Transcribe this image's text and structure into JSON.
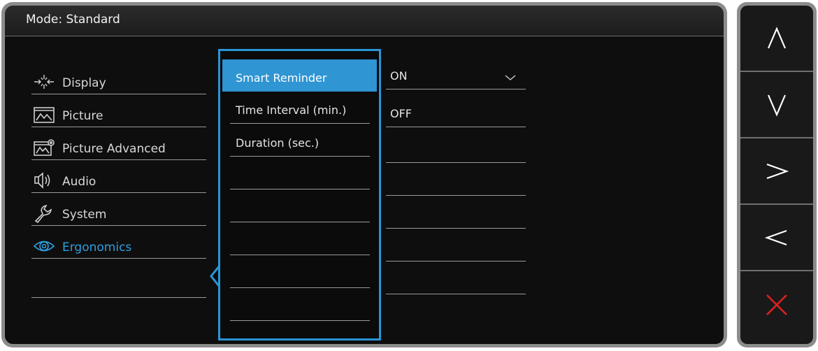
{
  "header": {
    "mode_label": "Mode: Standard"
  },
  "menu": {
    "items": [
      {
        "label": "Display",
        "icon": "display-icon"
      },
      {
        "label": "Picture",
        "icon": "picture-icon"
      },
      {
        "label": "Picture Advanced",
        "icon": "picture-advanced-icon"
      },
      {
        "label": "Audio",
        "icon": "speaker-icon"
      },
      {
        "label": "System",
        "icon": "wrench-icon"
      },
      {
        "label": "Ergonomics",
        "icon": "eye-icon",
        "active": true
      }
    ]
  },
  "submenu": {
    "items": [
      {
        "label": "Smart Reminder",
        "selected": true
      },
      {
        "label": "Time Interval (min.)"
      },
      {
        "label": "Duration (sec.)"
      }
    ]
  },
  "options": {
    "items": [
      {
        "label": "ON"
      },
      {
        "label": "OFF"
      }
    ]
  },
  "nav": {
    "buttons": [
      "up-arrow-icon",
      "down-arrow-icon",
      "right-arrow-icon",
      "left-arrow-icon",
      "close-icon"
    ]
  },
  "colors": {
    "accent": "#2f95d3",
    "close": "#e02020"
  }
}
